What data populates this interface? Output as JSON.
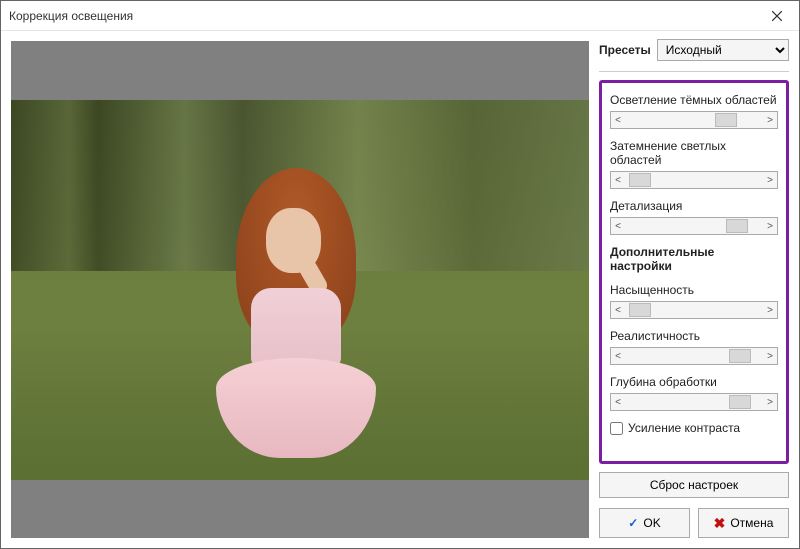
{
  "titlebar": {
    "title": "Коррекция освещения"
  },
  "presets": {
    "label": "Пресеты",
    "selected": "Исходный"
  },
  "sliders": {
    "lighten_dark": {
      "label": "Осветление тёмных областей",
      "pos": 65
    },
    "darken_light": {
      "label": "Затемнение светлых областей",
      "pos": 3
    },
    "detail": {
      "label": "Детализация",
      "pos": 73
    },
    "saturation": {
      "label": "Насыщенность",
      "pos": 3
    },
    "realism": {
      "label": "Реалистичность",
      "pos": 75
    },
    "depth": {
      "label": "Глубина обработки",
      "pos": 75
    }
  },
  "section_header": "Дополнительные настройки",
  "checkbox": {
    "label": "Усиление контраста",
    "checked": false
  },
  "buttons": {
    "reset": "Сброс настроек",
    "ok": "OK",
    "cancel": "Отмена"
  }
}
